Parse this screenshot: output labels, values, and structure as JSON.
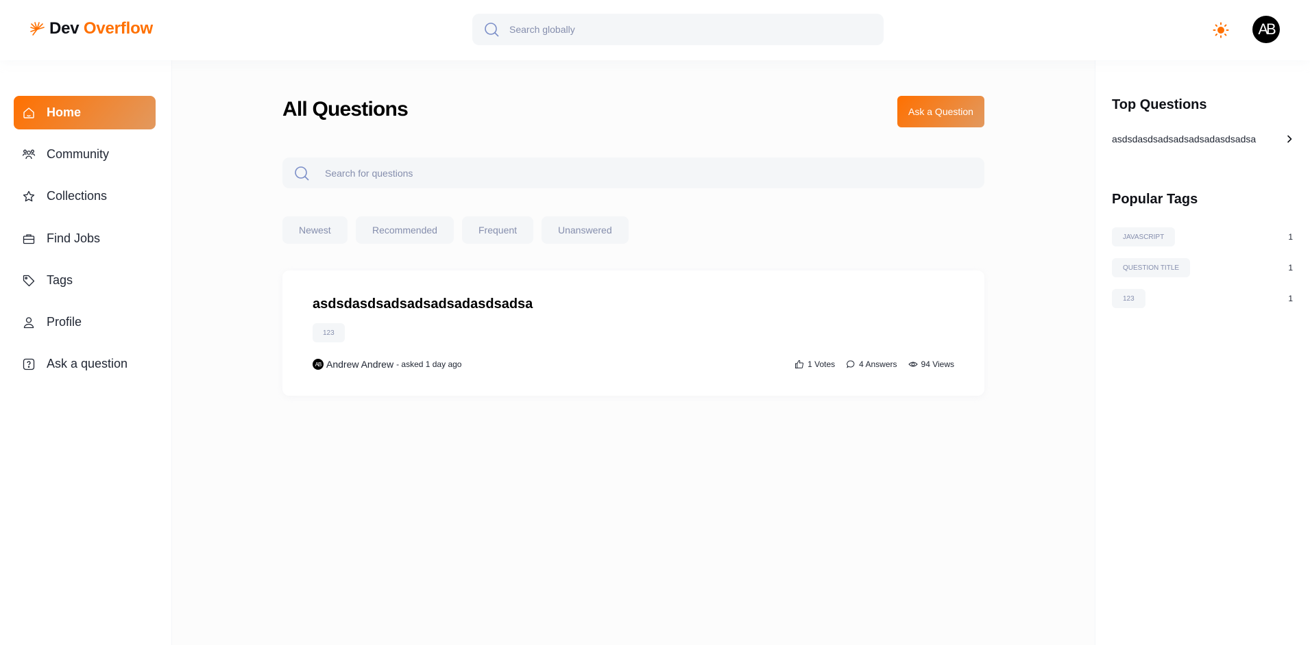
{
  "header": {
    "logo_part1": "Dev",
    "logo_part2": "Overflow",
    "search_placeholder": "Search globally",
    "avatar_initials": "AB",
    "brand_color": "#ff7000"
  },
  "sidebar": {
    "items": [
      {
        "label": "Home",
        "icon": "home-icon",
        "active": true
      },
      {
        "label": "Community",
        "icon": "users-icon"
      },
      {
        "label": "Collections",
        "icon": "star-icon"
      },
      {
        "label": "Find Jobs",
        "icon": "suitcase-icon"
      },
      {
        "label": "Tags",
        "icon": "tag-icon"
      },
      {
        "label": "Profile",
        "icon": "user-icon"
      },
      {
        "label": "Ask a question",
        "icon": "question-icon"
      }
    ]
  },
  "main": {
    "title": "All Questions",
    "ask_button": "Ask a Question",
    "search_placeholder": "Search for questions",
    "filters": [
      "Newest",
      "Recommended",
      "Frequent",
      "Unanswered"
    ],
    "questions": [
      {
        "title": "asdsdasdsadsadsadsadasdsadsa",
        "tags": [
          "123"
        ],
        "author": "Andrew Andrew",
        "author_initials": "AB",
        "asked": "- asked 1 day ago",
        "votes": "1 Votes",
        "answers": "4 Answers",
        "views": "94 Views"
      }
    ]
  },
  "rightbar": {
    "top_questions_heading": "Top Questions",
    "top_questions": [
      "asdsdasdsadsadsadsadasdsadsa"
    ],
    "popular_tags_heading": "Popular Tags",
    "popular_tags": [
      {
        "name": "JAVASCRIPT",
        "count": "1"
      },
      {
        "name": "QUESTION TITLE",
        "count": "1"
      },
      {
        "name": "123",
        "count": "1"
      }
    ]
  }
}
